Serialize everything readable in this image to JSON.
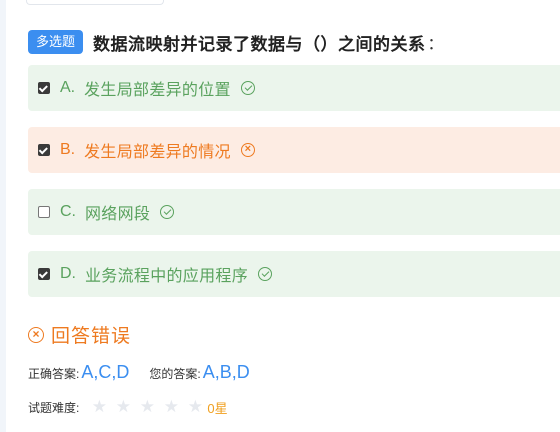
{
  "question": {
    "type_label": "多选题",
    "text": "数据流映射并记录了数据与（）之间的关系",
    "colon": "："
  },
  "options": [
    {
      "letter": "A.",
      "text": "发生局部差异的位置",
      "checked": true,
      "status": "correct"
    },
    {
      "letter": "B.",
      "text": "发生局部差异的情况",
      "checked": true,
      "status": "wrong"
    },
    {
      "letter": "C.",
      "text": "网络网段",
      "checked": false,
      "status": "correct"
    },
    {
      "letter": "D.",
      "text": "业务流程中的应用程序",
      "checked": true,
      "status": "correct"
    }
  ],
  "result": {
    "text": "回答错误",
    "icon": "x-circle-icon"
  },
  "answers": {
    "correct_label": "正确答案:",
    "correct_value": "A,C,D",
    "yours_label": "您的答案:",
    "yours_value": "A,B,D"
  },
  "difficulty": {
    "label": "试题难度:",
    "stars_total": 5,
    "stars_filled": 0,
    "value_text": "0星"
  },
  "colors": {
    "correct_bg": "#ebf5ec",
    "correct_text": "#5aa25e",
    "wrong_bg": "#fdece3",
    "wrong_text": "#ee7a20",
    "accent": "#3b8ef0"
  }
}
